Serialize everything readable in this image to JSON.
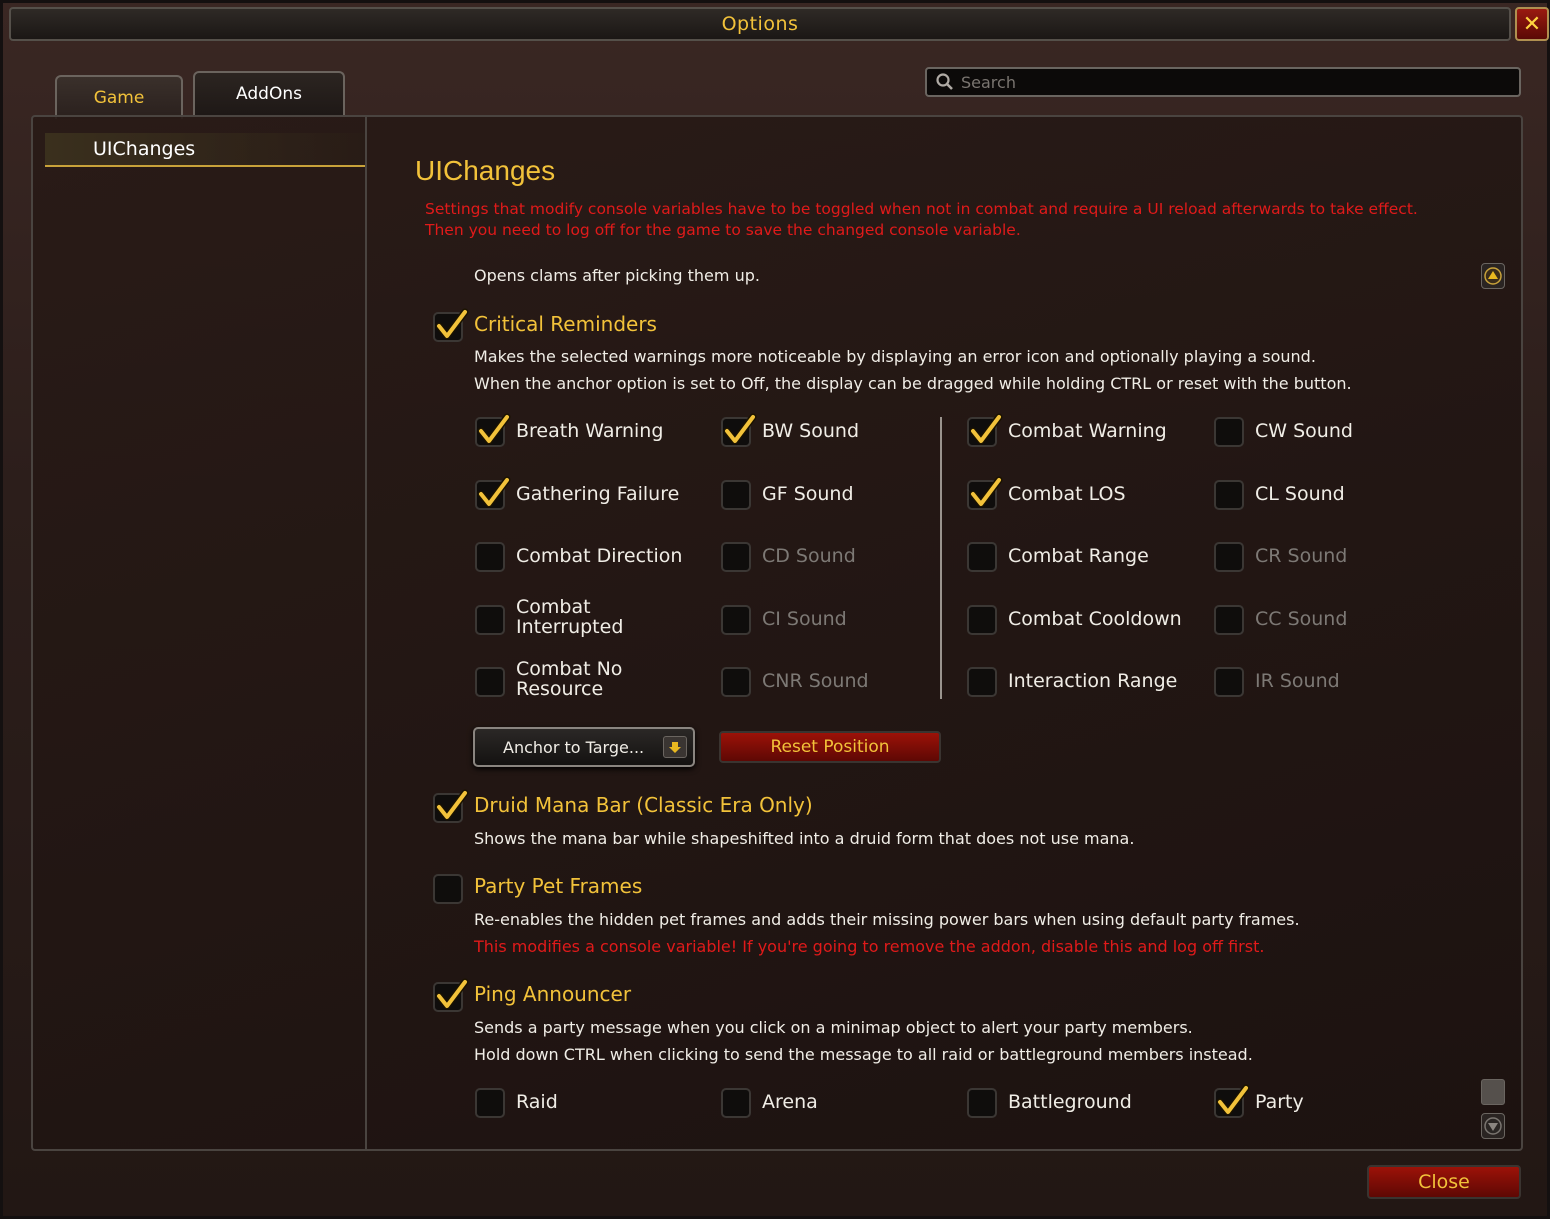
{
  "window": {
    "title": "Options"
  },
  "tabs": [
    {
      "label": "Game"
    },
    {
      "label": "AddOns"
    }
  ],
  "search": {
    "placeholder": "Search"
  },
  "sidebar": {
    "items": [
      {
        "label": "UIChanges"
      }
    ]
  },
  "main": {
    "title": "UIChanges",
    "warning": "Settings that modify console variables have to be toggled when not in combat and require a UI reload afterwards to take effect. Then you need to log off for the game to save the changed console variable.",
    "prev_desc": "Opens clams after picking them up.",
    "critical": {
      "label": "Critical Reminders",
      "checked": true,
      "desc1": "Makes the selected warnings more noticeable by displaying an error icon and optionally playing a sound.",
      "desc2": "When the anchor option is set to Off, the display can be dragged while holding CTRL or reset with the button.",
      "grid": [
        {
          "label": "Breath Warning",
          "checked": true,
          "dim": false
        },
        {
          "label": "BW Sound",
          "checked": true,
          "dim": false
        },
        {
          "label": "Combat Warning",
          "checked": true,
          "dim": false
        },
        {
          "label": "CW Sound",
          "checked": false,
          "dim": false
        },
        {
          "label": "Gathering Failure",
          "checked": true,
          "dim": false
        },
        {
          "label": "GF Sound",
          "checked": false,
          "dim": false
        },
        {
          "label": "Combat LOS",
          "checked": true,
          "dim": false
        },
        {
          "label": "CL Sound",
          "checked": false,
          "dim": false
        },
        {
          "label": "Combat Direction",
          "checked": false,
          "dim": false
        },
        {
          "label": "CD Sound",
          "checked": false,
          "dim": true
        },
        {
          "label": "Combat Range",
          "checked": false,
          "dim": false
        },
        {
          "label": "CR Sound",
          "checked": false,
          "dim": true
        },
        {
          "label": "Combat Interrupted",
          "checked": false,
          "dim": false
        },
        {
          "label": "CI Sound",
          "checked": false,
          "dim": true
        },
        {
          "label": "Combat Cooldown",
          "checked": false,
          "dim": false
        },
        {
          "label": "CC Sound",
          "checked": false,
          "dim": true
        },
        {
          "label": "Combat No Resource",
          "checked": false,
          "dim": false
        },
        {
          "label": "CNR Sound",
          "checked": false,
          "dim": true
        },
        {
          "label": "Interaction Range",
          "checked": false,
          "dim": false
        },
        {
          "label": "IR Sound",
          "checked": false,
          "dim": true
        }
      ],
      "anchor_dropdown": "Anchor to Targe...",
      "reset_button": "Reset Position"
    },
    "druid": {
      "label": "Druid Mana Bar (Classic Era Only)",
      "checked": true,
      "desc": "Shows the mana bar while shapeshifted into a druid form that does not use mana."
    },
    "partypet": {
      "label": "Party Pet Frames",
      "checked": false,
      "desc": "Re-enables the hidden pet frames and adds their missing power bars when using default party frames.",
      "warn": "This modifies a console variable! If you're going to remove the addon, disable this and log off first."
    },
    "ping": {
      "label": "Ping Announcer",
      "checked": true,
      "desc1": "Sends a party message when you click on a minimap object to alert your party members.",
      "desc2": "Hold down CTRL when clicking to send the message to all raid or battleground members instead.",
      "options": [
        {
          "label": "Raid",
          "checked": false
        },
        {
          "label": "Arena",
          "checked": false
        },
        {
          "label": "Battleground",
          "checked": false
        },
        {
          "label": "Party",
          "checked": true
        }
      ]
    }
  },
  "footer": {
    "close_label": "Close"
  },
  "colors": {
    "gold": "#f2c23a",
    "warn_red": "#e01a1a"
  }
}
